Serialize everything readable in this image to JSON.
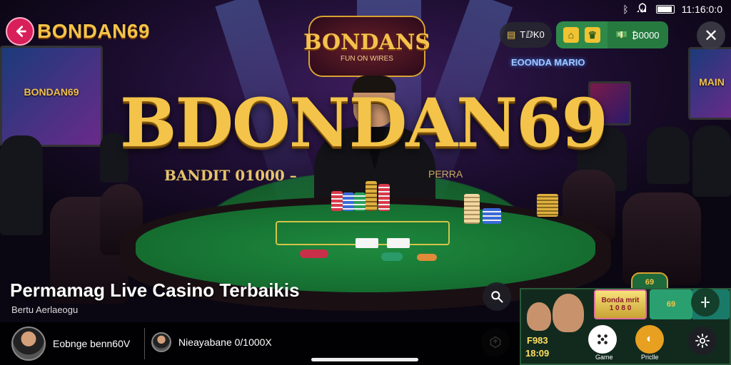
{
  "header": {
    "brand": "BONDAN69",
    "back_icon": "arrow-left-icon"
  },
  "status_bar": {
    "time": "11:16:0:0"
  },
  "toolbar": {
    "pill_label": "TⅅK0",
    "balance": "₿0000",
    "home_icon": "home-icon",
    "crown_icon": "crown-icon",
    "wallet_icon": "wallet-icon",
    "close_icon": "close-icon"
  },
  "scene": {
    "emblem_title": "BONDANS",
    "emblem_sub": "FUN ON WIRES",
    "logo_text": "BDONDAN69",
    "subline": "BANDIT 01000 –",
    "subline_right": "PERRA",
    "neon_sign": "EOONDA MARIO",
    "tv_left_title": "BONDAN69",
    "tv_right_title": "MAIN"
  },
  "stream": {
    "title": "Permamag Live Casino Terbaikis",
    "subtitle": "Bertu Aerlaeogu"
  },
  "bottom_bar": {
    "user1": "Eobnge benn60V",
    "user2": "Nieayabane 0/1000X"
  },
  "mini_game": {
    "top_badge": "69",
    "slot_line1": "Bonda mrit",
    "slot_line2": "1 0 8 0",
    "green_label": "69",
    "amount_top": "F983",
    "amount_bottom": "18:09",
    "grid_label": "Game",
    "coin_label": "Priclle"
  },
  "colors": {
    "accent_gold": "#f3c449",
    "back_button": "#d81f5a",
    "felt_green": "#1e8a3e",
    "toolbar_green": "#2f8a4a"
  }
}
